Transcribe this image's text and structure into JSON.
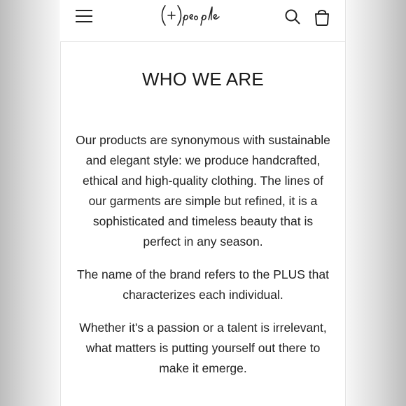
{
  "header": {
    "brand": "(+)people",
    "menu_icon": "hamburger-menu-icon",
    "search_icon": "search-icon",
    "cart_icon": "shopping-bag-icon"
  },
  "page": {
    "title": "WHO WE ARE",
    "paragraphs": [
      "Our products are synonymous with sustainable and elegant style: we produce handcrafted, ethical and high-quality clothing. The lines of our garments are simple but refined, it is a sophisticated and timeless beauty that is perfect in any season.",
      "The name of the brand refers to the PLUS that characterizes each individual.",
      "Whether it's a passion or a talent is irrelevant, what matters is putting yourself out there to make it emerge."
    ]
  },
  "colors": {
    "text": "#1c1c1c",
    "background": "#ffffff",
    "divider": "#e6e6e6"
  }
}
